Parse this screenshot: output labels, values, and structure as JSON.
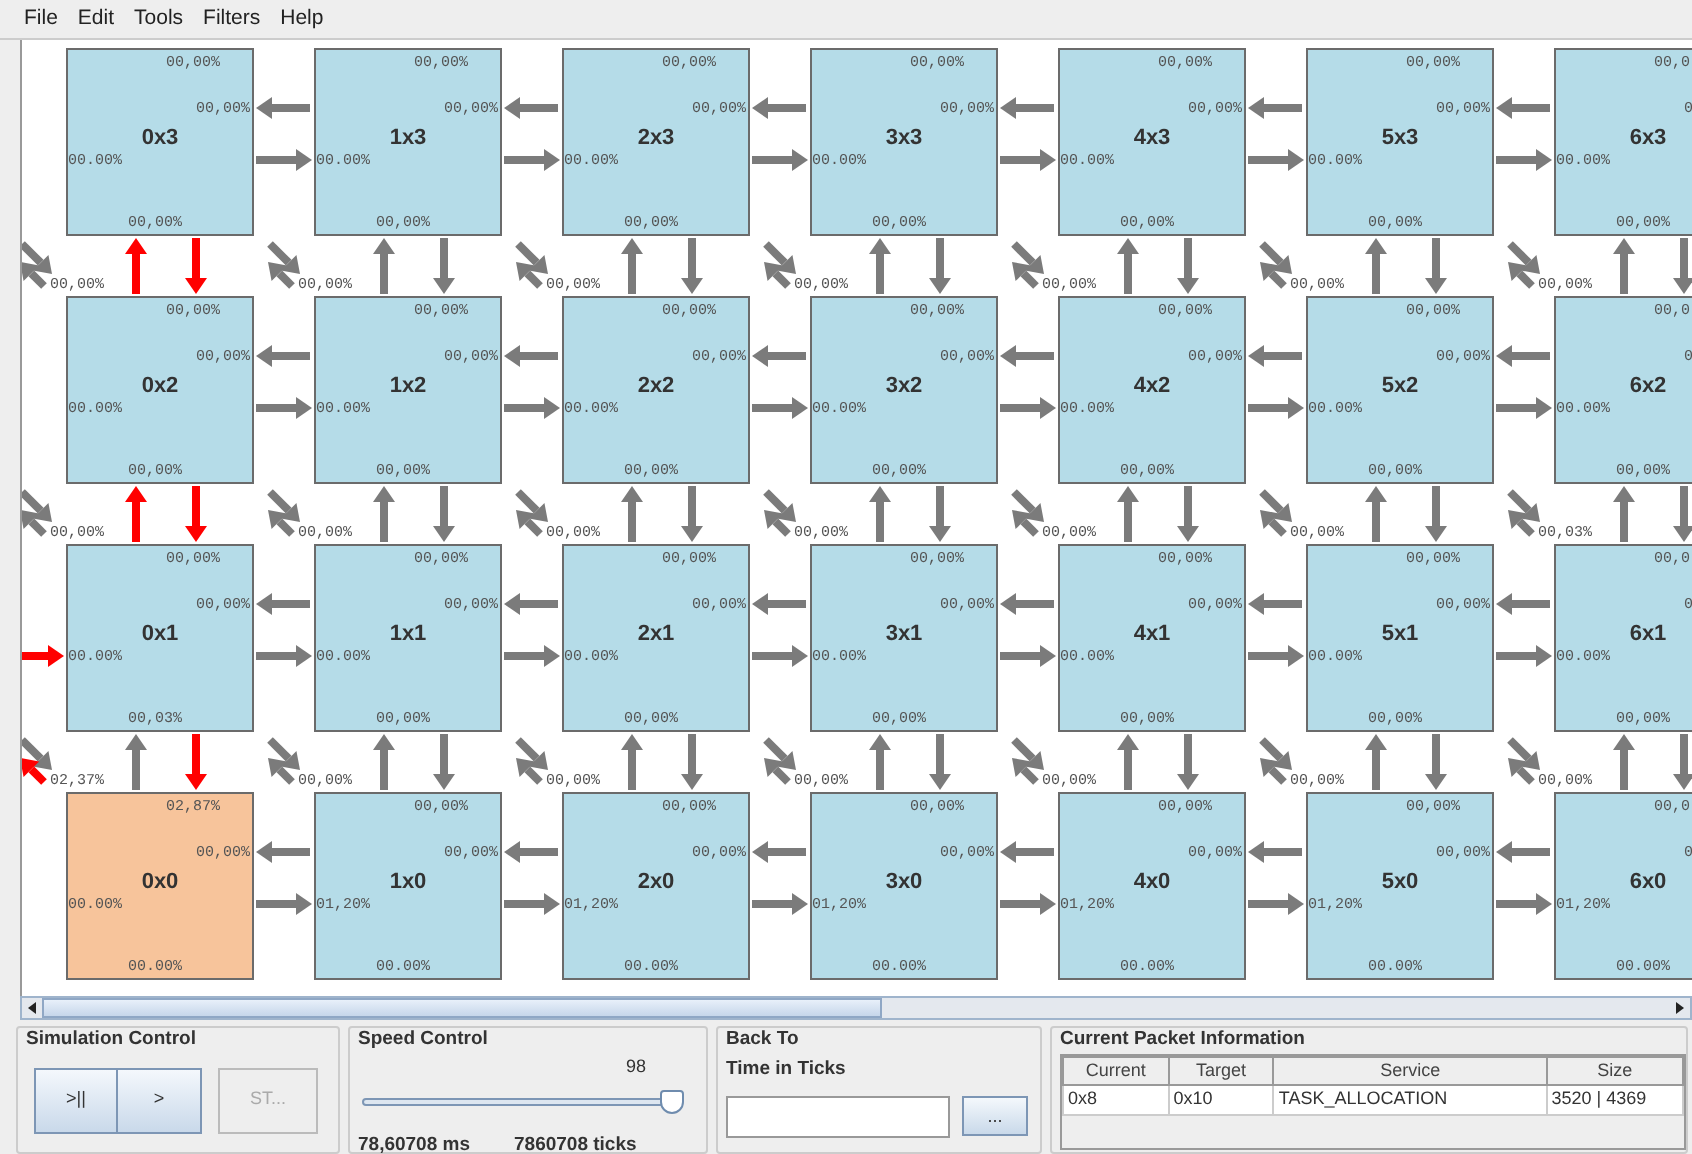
{
  "menu": [
    "File",
    "Edit",
    "Tools",
    "Filters",
    "Help"
  ],
  "tiles": [
    {
      "name": "0x3",
      "highlighted": false,
      "labels": {
        "north": "00,00%",
        "east": "00,00%",
        "west": "00.00%",
        "south": "00,00%"
      }
    },
    {
      "name": "1x3",
      "highlighted": false,
      "labels": {
        "north": "00,00%",
        "east": "00,00%",
        "west": "00.00%",
        "south": "00,00%"
      },
      "links": {
        "west_out": false,
        "west_in": false
      }
    },
    {
      "name": "2x3",
      "highlighted": false,
      "labels": {
        "north": "00,00%",
        "east": "00,00%",
        "west": "00.00%",
        "south": "00,00%"
      },
      "links": {
        "west_out": false,
        "west_in": false
      }
    },
    {
      "name": "3x3",
      "highlighted": false,
      "labels": {
        "north": "00,00%",
        "east": "00,00%",
        "west": "00.00%",
        "south": "00,00%"
      },
      "links": {
        "west_out": false,
        "west_in": false
      }
    },
    {
      "name": "4x3",
      "highlighted": false,
      "labels": {
        "north": "00,00%",
        "east": "00,00%",
        "west": "00.00%",
        "south": "00,00%"
      },
      "links": {
        "west_out": false,
        "west_in": false
      }
    },
    {
      "name": "5x3",
      "highlighted": false,
      "labels": {
        "north": "00,00%",
        "east": "00,00%",
        "west": "00.00%",
        "south": "00,00%"
      },
      "links": {
        "west_out": false,
        "west_in": false
      }
    },
    {
      "name": "6x3",
      "highlighted": false,
      "labels": {
        "north": "00,0",
        "east": "0",
        "west": "00.00%",
        "south": "00,00%"
      },
      "links": {
        "west_out": false,
        "west_in": false
      }
    },
    {
      "name": "0x2",
      "highlighted": false,
      "labels": {
        "local": "00,00%",
        "north": "00,00%",
        "east": "00,00%",
        "west": "00.00%",
        "south": "00,00%"
      },
      "links": {
        "north_out": true,
        "north_in": true,
        "local_in": false,
        "local_out": false
      }
    },
    {
      "name": "1x2",
      "highlighted": false,
      "labels": {
        "local": "00,00%",
        "north": "00,00%",
        "east": "00,00%",
        "west": "00.00%",
        "south": "00,00%"
      },
      "links": {
        "north_out": false,
        "north_in": false,
        "west_out": false,
        "west_in": false,
        "local_in": false,
        "local_out": false
      }
    },
    {
      "name": "2x2",
      "highlighted": false,
      "labels": {
        "local": "00,00%",
        "north": "00,00%",
        "east": "00,00%",
        "west": "00.00%",
        "south": "00,00%"
      },
      "links": {
        "north_out": false,
        "north_in": false,
        "west_out": false,
        "west_in": false,
        "local_in": false,
        "local_out": false
      }
    },
    {
      "name": "3x2",
      "highlighted": false,
      "labels": {
        "local": "00,00%",
        "north": "00,00%",
        "east": "00,00%",
        "west": "00.00%",
        "south": "00,00%"
      },
      "links": {
        "north_out": false,
        "north_in": false,
        "west_out": false,
        "west_in": false,
        "local_in": false,
        "local_out": false
      }
    },
    {
      "name": "4x2",
      "highlighted": false,
      "labels": {
        "local": "00,00%",
        "north": "00,00%",
        "east": "00,00%",
        "west": "00.00%",
        "south": "00,00%"
      },
      "links": {
        "north_out": false,
        "north_in": false,
        "west_out": false,
        "west_in": false,
        "local_in": false,
        "local_out": false
      }
    },
    {
      "name": "5x2",
      "highlighted": false,
      "labels": {
        "local": "00,00%",
        "north": "00,00%",
        "east": "00,00%",
        "west": "00.00%",
        "south": "00,00%"
      },
      "links": {
        "north_out": false,
        "north_in": false,
        "west_out": false,
        "west_in": false,
        "local_in": false,
        "local_out": false
      }
    },
    {
      "name": "6x2",
      "highlighted": false,
      "labels": {
        "local": "00,00%",
        "north": "00,0",
        "east": "0",
        "west": "00.00%",
        "south": "00,00%"
      },
      "links": {
        "north_out": false,
        "north_in": false,
        "west_out": false,
        "west_in": false,
        "local_in": false,
        "local_out": false
      }
    },
    {
      "name": "0x1",
      "highlighted": false,
      "labels": {
        "local": "00,00%",
        "north": "00,00%",
        "east": "00,00%",
        "west": "00.00%",
        "south": "00,03%"
      },
      "links": {
        "north_out": true,
        "north_in": true,
        "west_in": true,
        "local_in": false,
        "local_out": false
      }
    },
    {
      "name": "1x1",
      "highlighted": false,
      "labels": {
        "local": "00,00%",
        "north": "00,00%",
        "east": "00,00%",
        "west": "00.00%",
        "south": "00,00%"
      },
      "links": {
        "north_out": false,
        "north_in": false,
        "west_out": false,
        "west_in": false,
        "local_in": false,
        "local_out": false
      }
    },
    {
      "name": "2x1",
      "highlighted": false,
      "labels": {
        "local": "00,00%",
        "north": "00,00%",
        "east": "00,00%",
        "west": "00.00%",
        "south": "00,00%"
      },
      "links": {
        "north_out": false,
        "north_in": false,
        "west_out": false,
        "west_in": false,
        "local_in": false,
        "local_out": false
      }
    },
    {
      "name": "3x1",
      "highlighted": false,
      "labels": {
        "local": "00,00%",
        "north": "00,00%",
        "east": "00,00%",
        "west": "00.00%",
        "south": "00,00%"
      },
      "links": {
        "north_out": false,
        "north_in": false,
        "west_out": false,
        "west_in": false,
        "local_in": false,
        "local_out": false
      }
    },
    {
      "name": "4x1",
      "highlighted": false,
      "labels": {
        "local": "00,00%",
        "north": "00,00%",
        "east": "00,00%",
        "west": "00.00%",
        "south": "00,00%"
      },
      "links": {
        "north_out": false,
        "north_in": false,
        "west_out": false,
        "west_in": false,
        "local_in": false,
        "local_out": false
      }
    },
    {
      "name": "5x1",
      "highlighted": false,
      "labels": {
        "local": "00,00%",
        "north": "00,00%",
        "east": "00,00%",
        "west": "00.00%",
        "south": "00,00%"
      },
      "links": {
        "north_out": false,
        "north_in": false,
        "west_out": false,
        "west_in": false,
        "local_in": false,
        "local_out": false
      }
    },
    {
      "name": "6x1",
      "highlighted": false,
      "labels": {
        "local": "00,03%",
        "north": "00,0",
        "east": "0",
        "west": "00.00%",
        "south": "00,00%"
      },
      "links": {
        "north_out": false,
        "north_in": false,
        "west_out": false,
        "west_in": false,
        "local_in": false,
        "local_out": false
      }
    },
    {
      "name": "0x0",
      "highlighted": true,
      "labels": {
        "local": "02,37%",
        "north": "02,87%",
        "east": "00,00%",
        "west": "00.00%",
        "south": "00.00%"
      },
      "links": {
        "north_out": false,
        "north_in": true,
        "local_in": false,
        "local_out": true
      }
    },
    {
      "name": "1x0",
      "highlighted": false,
      "labels": {
        "local": "00,00%",
        "north": "00,00%",
        "east": "00,00%",
        "west": "01,20%",
        "south": "00.00%"
      },
      "links": {
        "north_out": false,
        "north_in": false,
        "west_out": false,
        "west_in": false,
        "local_in": false,
        "local_out": false
      }
    },
    {
      "name": "2x0",
      "highlighted": false,
      "labels": {
        "local": "00,00%",
        "north": "00,00%",
        "east": "00,00%",
        "west": "01,20%",
        "south": "00.00%"
      },
      "links": {
        "north_out": false,
        "north_in": false,
        "west_out": false,
        "west_in": false,
        "local_in": false,
        "local_out": false
      }
    },
    {
      "name": "3x0",
      "highlighted": false,
      "labels": {
        "local": "00,00%",
        "north": "00,00%",
        "east": "00,00%",
        "west": "01,20%",
        "south": "00.00%"
      },
      "links": {
        "north_out": false,
        "north_in": false,
        "west_out": false,
        "west_in": false,
        "local_in": false,
        "local_out": false
      }
    },
    {
      "name": "4x0",
      "highlighted": false,
      "labels": {
        "local": "00,00%",
        "north": "00,00%",
        "east": "00,00%",
        "west": "01,20%",
        "south": "00.00%"
      },
      "links": {
        "north_out": false,
        "north_in": false,
        "west_out": false,
        "west_in": false,
        "local_in": false,
        "local_out": false
      }
    },
    {
      "name": "5x0",
      "highlighted": false,
      "labels": {
        "local": "00,00%",
        "north": "00,00%",
        "east": "00,00%",
        "west": "01,20%",
        "south": "00.00%"
      },
      "links": {
        "north_out": false,
        "north_in": false,
        "west_out": false,
        "west_in": false,
        "local_in": false,
        "local_out": false
      }
    },
    {
      "name": "6x0",
      "highlighted": false,
      "labels": {
        "local": "00,00%",
        "north": "00,0",
        "east": "0",
        "west": "01,20%",
        "south": "00.00%"
      },
      "links": {
        "north_out": false,
        "north_in": false,
        "west_out": false,
        "west_in": false,
        "local_in": false,
        "local_out": false
      }
    }
  ],
  "simulation_control": {
    "title": "Simulation Control",
    "buttons": [
      {
        "label": ">||",
        "disabled": false
      },
      {
        "label": ">",
        "disabled": false
      },
      {
        "label": "ST...",
        "disabled": true
      }
    ]
  },
  "speed_control": {
    "title": "Speed Control",
    "value": "98",
    "level": 0.98,
    "time_ms": "78,60708 ms",
    "time_ticks": "7860708 ticks"
  },
  "back_to": {
    "title": "Back To",
    "field_label": "Time in Ticks",
    "button": "..."
  },
  "packet_info": {
    "title": "Current Packet Information",
    "columns": [
      "Current",
      "Target",
      "Service",
      "Size"
    ],
    "rows": [
      [
        "0x8",
        "0x10",
        "TASK_ALLOCATION",
        "3520 | 4369"
      ]
    ]
  }
}
